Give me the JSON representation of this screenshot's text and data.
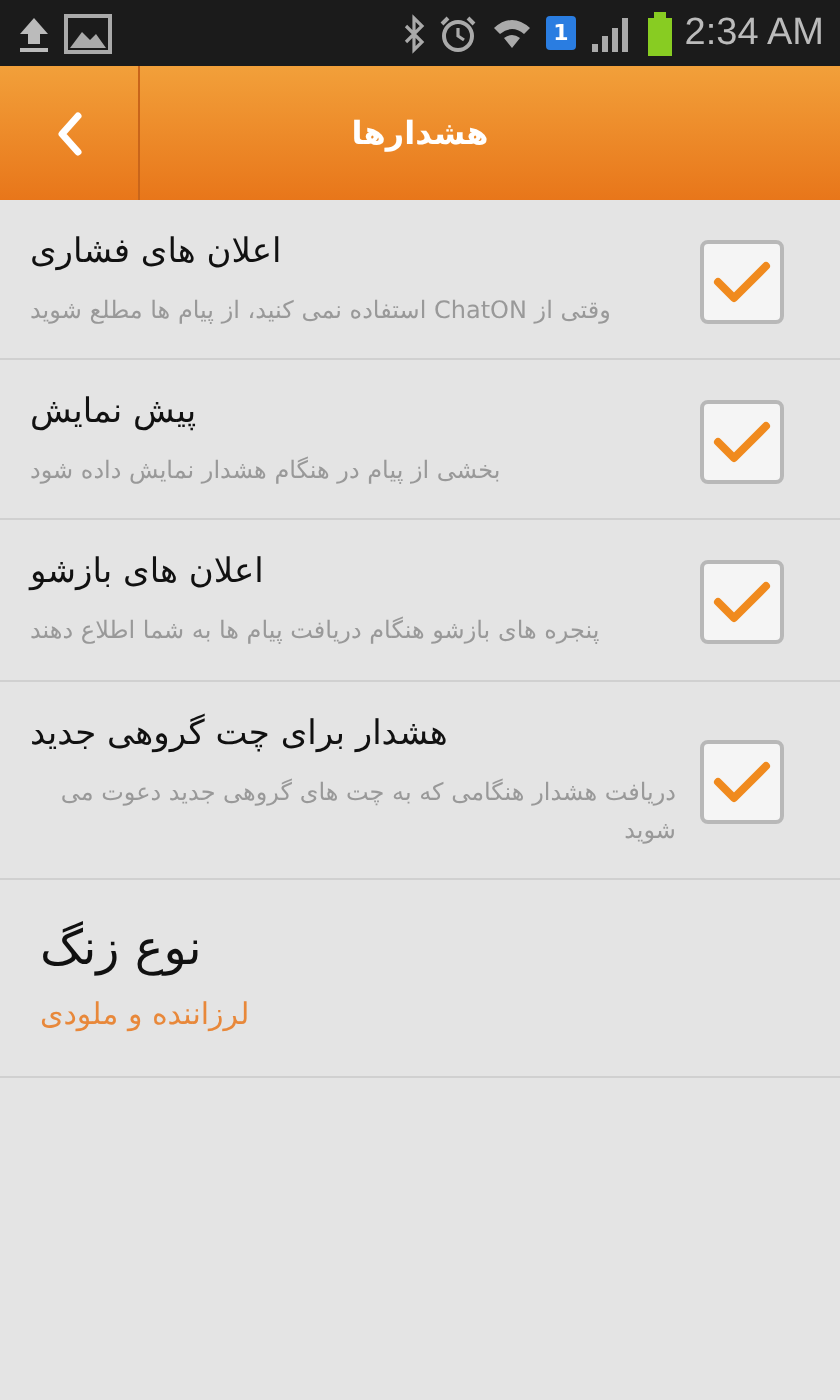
{
  "status_bar": {
    "time": "2:34 AM",
    "sim_badge": "1"
  },
  "action_bar": {
    "title": "هشدارها"
  },
  "settings": [
    {
      "kind": "checkbox",
      "title": "اعلان های فشاری",
      "description": "وقتی از ChatON استفاده نمی کنید، از پیام ها مطلع شوید",
      "checked": true
    },
    {
      "kind": "checkbox",
      "title": "پیش نمایش",
      "description": "بخشی از پیام در هنگام هشدار نمایش داده شود",
      "checked": true
    },
    {
      "kind": "checkbox",
      "title": "اعلان های بازشو",
      "description": "پنجره های بازشو هنگام دریافت پیام ها به شما اطلاع دهند",
      "checked": true
    },
    {
      "kind": "checkbox",
      "title": "هشدار برای چت گروهی جدید",
      "description": "دریافت هشدار هنگامی که به چت های گروهی جدید دعوت می شوید",
      "checked": true
    },
    {
      "kind": "value",
      "title": "نوع زنگ",
      "value": "لرزاننده و ملودی"
    }
  ]
}
